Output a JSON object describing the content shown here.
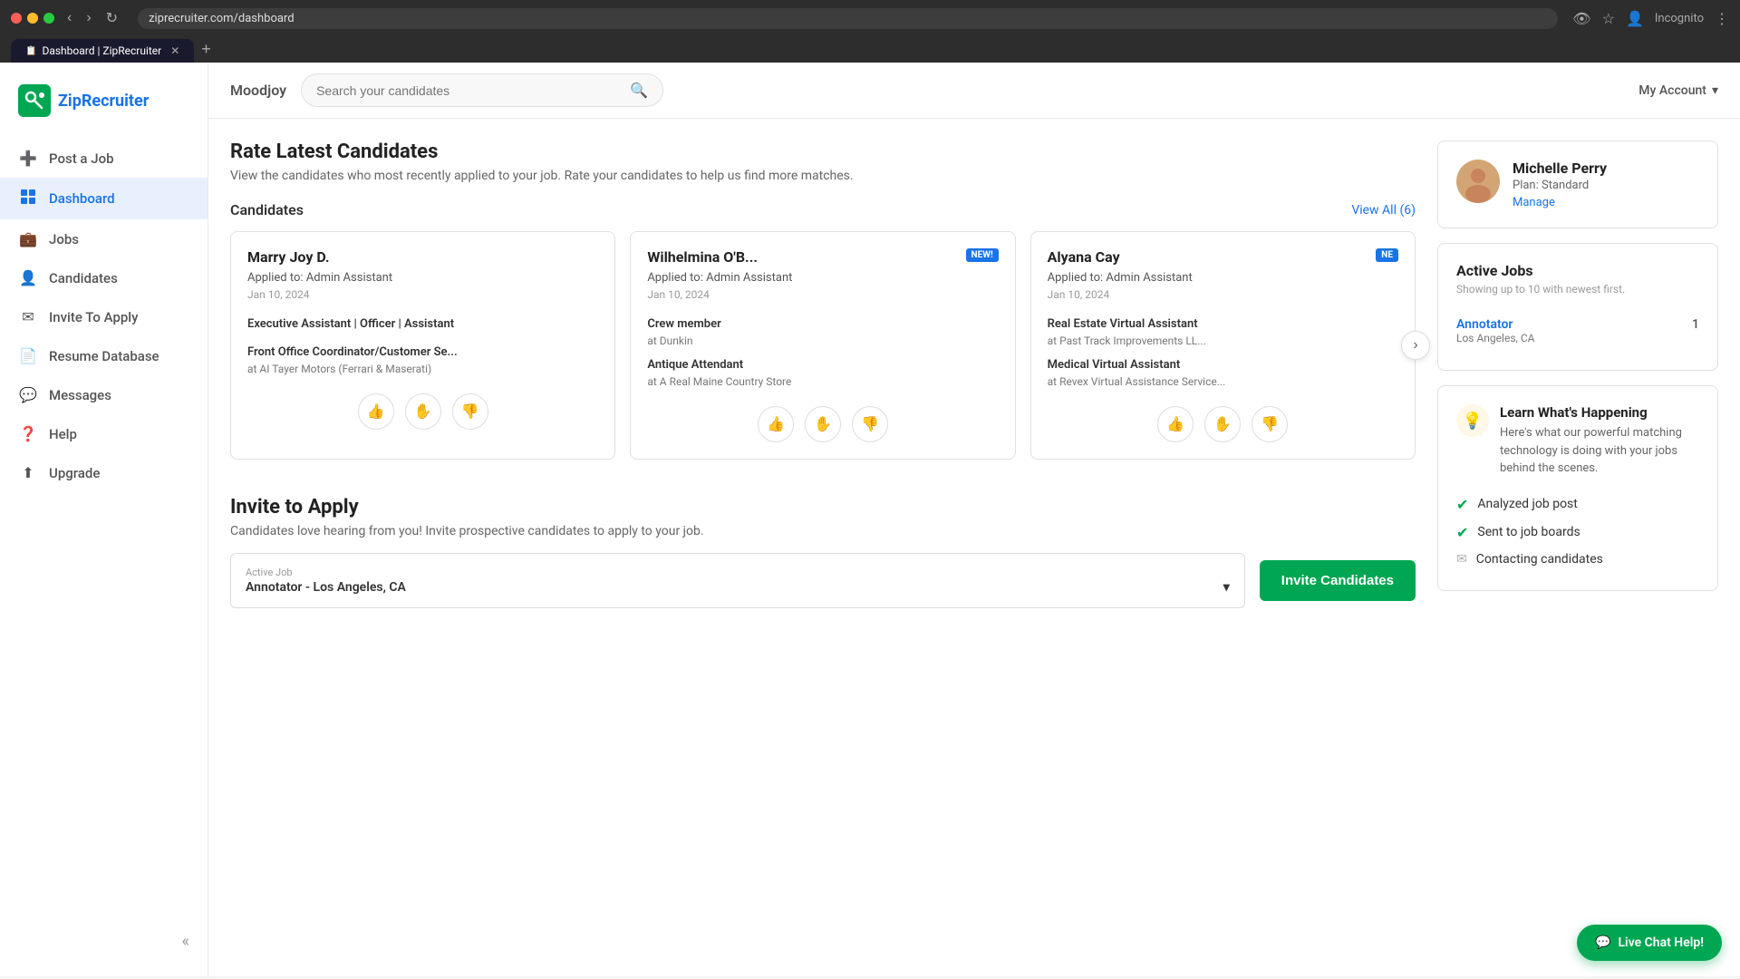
{
  "browser": {
    "url": "ziprecruiter.com/dashboard",
    "tab_title": "Dashboard | ZipRecruiter",
    "tab_favicon": "📋"
  },
  "topbar": {
    "company_name": "Moodjoy",
    "search_placeholder": "Search your candidates",
    "my_account_label": "My Account"
  },
  "sidebar": {
    "logo_text": "ZipRecruiter",
    "items": [
      {
        "label": "Post a Job",
        "icon": "➕",
        "active": false
      },
      {
        "label": "Dashboard",
        "icon": "⊞",
        "active": true
      },
      {
        "label": "Jobs",
        "icon": "💼",
        "active": false
      },
      {
        "label": "Candidates",
        "icon": "👤",
        "active": false
      },
      {
        "label": "Invite To Apply",
        "icon": "✉",
        "active": false
      },
      {
        "label": "Resume Database",
        "icon": "📄",
        "active": false
      },
      {
        "label": "Messages",
        "icon": "💬",
        "active": false
      },
      {
        "label": "Help",
        "icon": "❓",
        "active": false
      },
      {
        "label": "Upgrade",
        "icon": "⬆",
        "active": false
      }
    ]
  },
  "main": {
    "rate_section": {
      "title": "Rate Latest Candidates",
      "subtitle": "View the candidates who most recently applied to your job. Rate your candidates to help us find more matches.",
      "candidates_label": "Candidates",
      "view_all_label": "View All (6)",
      "candidates": [
        {
          "name": "Marry Joy D.",
          "applied_to": "Applied to: Admin Assistant",
          "date": "Jan 10, 2024",
          "job1_title": "Executive Assistant | Officer | Assistant",
          "job1_company": "",
          "job2_title": "Front Office Coordinator/Customer Se...",
          "job2_company": "at AI Tayer Motors (Ferrari & Maserati)",
          "is_new": false
        },
        {
          "name": "Wilhelmina O'B...",
          "applied_to": "Applied to: Admin Assistant",
          "date": "Jan 10, 2024",
          "job1_title": "Crew member",
          "job1_company": "at Dunkin",
          "job2_title": "Antique Attendant",
          "job2_company": "at A Real Maine Country Store",
          "is_new": true
        },
        {
          "name": "Alyana Cay",
          "applied_to": "Applied to: Admin Assistant",
          "date": "Jan 10, 2024",
          "job1_title": "Real Estate Virtual Assistant",
          "job1_company": "at Past Track Improvements LL...",
          "job2_title": "Medical Virtual Assistant",
          "job2_company": "at Revex Virtual Assistance Service...",
          "is_new": true
        }
      ]
    },
    "invite_section": {
      "title": "Invite to Apply",
      "subtitle": "Candidates love hearing from you! Invite prospective candidates to apply to your job.",
      "active_job_label": "Active Job",
      "active_job_value": "Annotator - Los Angeles, CA",
      "invite_btn_label": "Invite Candidates"
    }
  },
  "right_panel": {
    "profile": {
      "name": "Michelle Perry",
      "plan_label": "Plan: Standard",
      "manage_label": "Manage"
    },
    "active_jobs": {
      "title": "Active Jobs",
      "subtitle": "Showing up to 10 with newest first.",
      "jobs": [
        {
          "name": "Annotator",
          "location": "Los Angeles, CA",
          "count": "1"
        }
      ]
    },
    "learn": {
      "title": "Learn What's Happening",
      "description": "Here's what our powerful matching technology is doing with your jobs behind the scenes.",
      "items": [
        {
          "label": "Analyzed job post",
          "done": true
        },
        {
          "label": "Sent to job boards",
          "done": true
        },
        {
          "label": "Contacting candidates",
          "done": false
        }
      ]
    }
  },
  "live_chat": {
    "label": "Live Chat Help!"
  }
}
